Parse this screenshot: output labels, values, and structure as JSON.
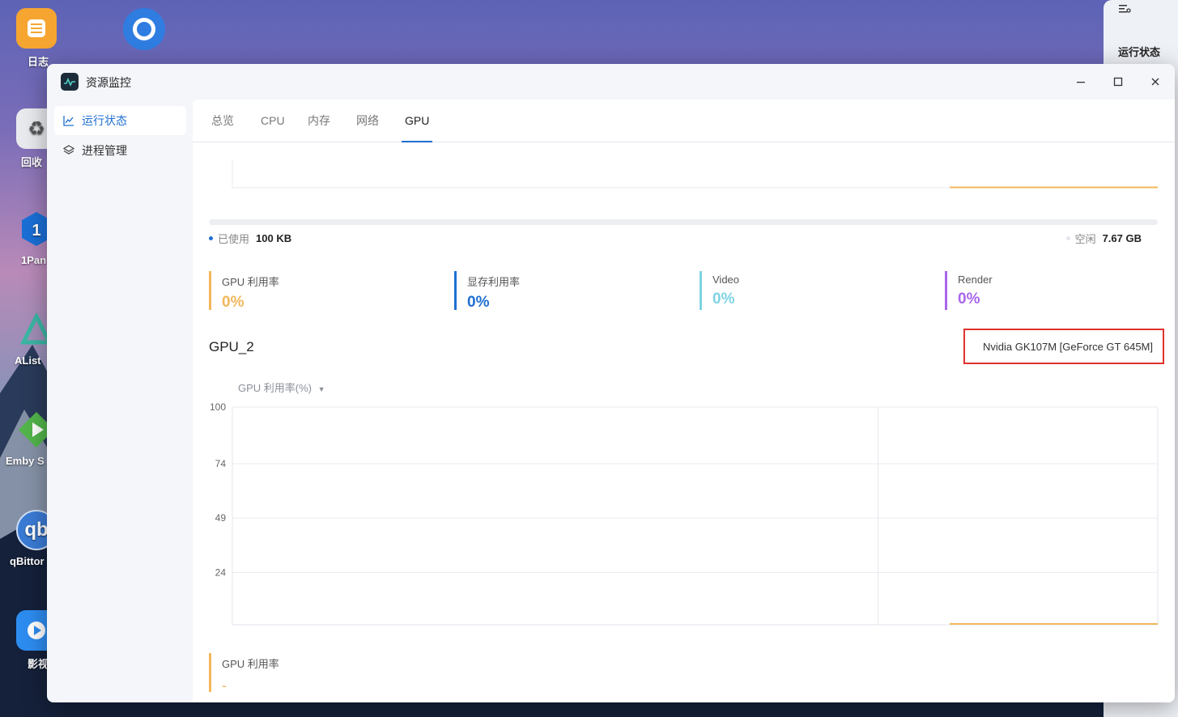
{
  "desktop": {
    "icons": [
      {
        "label": "日志",
        "color": "#f6a531"
      },
      {
        "label": "",
        "color": "#2f7de1"
      },
      {
        "label": "回收",
        "color": "#e8eaee"
      },
      {
        "label": "1Pan",
        "color": "#1a6fd6"
      },
      {
        "label": "AList",
        "color": "#3bb6a4"
      },
      {
        "label": "Emby S",
        "color": "#52b54b"
      },
      {
        "label": "qBittor",
        "color": "#3a7bd5"
      },
      {
        "label": "影视",
        "color": "#2d8cf0"
      }
    ]
  },
  "right_panel": {
    "status_label": "运行状态"
  },
  "window": {
    "title": "资源监控",
    "sidebar": {
      "items": [
        {
          "label": "运行状态",
          "active": true
        },
        {
          "label": "进程管理",
          "active": false
        }
      ]
    },
    "tabs": [
      {
        "label": "总览",
        "active": false
      },
      {
        "label": "CPU",
        "active": false
      },
      {
        "label": "内存",
        "active": false
      },
      {
        "label": "网络",
        "active": false
      },
      {
        "label": "GPU",
        "active": true
      }
    ],
    "memory": {
      "used_label": "已使用",
      "used_value": "100 KB",
      "free_label": "空闲",
      "free_value": "7.67 GB"
    },
    "metrics": [
      {
        "label": "GPU 利用率",
        "value": "0%",
        "color": "#f2b75b"
      },
      {
        "label": "显存利用率",
        "value": "0%",
        "color": "#1f6fd1"
      },
      {
        "label": "Video",
        "value": "0%",
        "color": "#7fd3e6"
      },
      {
        "label": "Render",
        "value": "0%",
        "color": "#a867ea"
      }
    ],
    "gpu": {
      "name": "GPU_2",
      "model": "Nvidia GK107M [GeForce GT 645M]"
    },
    "chart_select": "GPU 利用率(%)",
    "bottom_metric": {
      "label": "GPU 利用率",
      "value": "-"
    }
  },
  "chart_data": {
    "type": "line",
    "ylabel": "GPU 利用率(%)",
    "yticks": [
      100,
      74,
      49,
      24
    ],
    "ylim": [
      0,
      100
    ],
    "series": [
      {
        "values": [
          0,
          0,
          0,
          0,
          0,
          0,
          0,
          0,
          0,
          0,
          0,
          0,
          0,
          0,
          0,
          0,
          0,
          0,
          0,
          0
        ],
        "color": "#f2b75b"
      }
    ]
  }
}
